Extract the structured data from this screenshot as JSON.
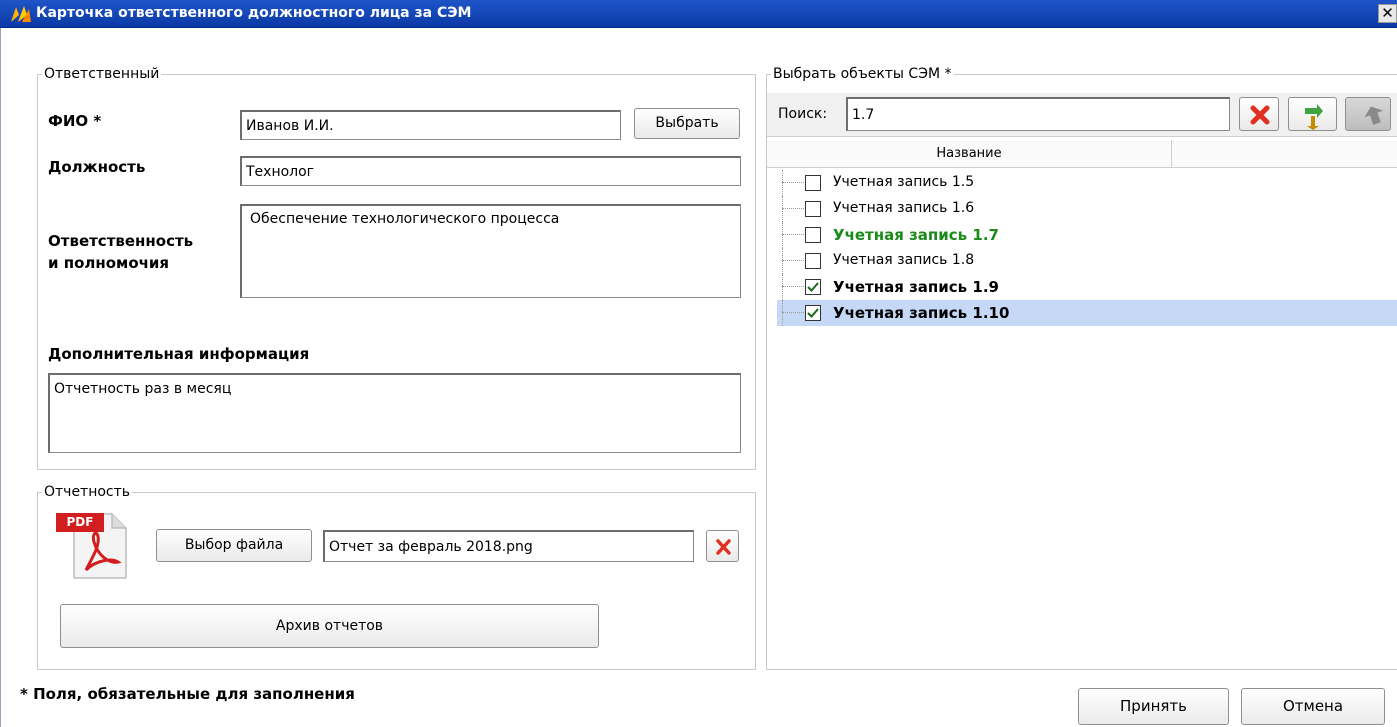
{
  "window": {
    "title": "Карточка ответственного должностного лица за СЭМ",
    "close_glyph": "✕"
  },
  "responsible": {
    "legend": "Ответственный",
    "fio_label": "ФИО *",
    "fio_value": "Иванов И.И.",
    "select_button": "Выбрать",
    "position_label": "Должность",
    "position_value": "Технолог",
    "duties_label_1": "Ответственность",
    "duties_label_2": "и полномочия",
    "duties_value": "Обеспечение технологического процесса",
    "extra_label": "Дополнительная информация",
    "extra_value": "Отчетность раз в месяц"
  },
  "reporting": {
    "legend": "Отчетность",
    "pdf_badge": "PDF",
    "choose_file_button": "Выбор файла",
    "file_value": "Отчет за февраль 2018.png",
    "archive_button": "Архив отчетов"
  },
  "objects": {
    "legend": "Выбрать объекты СЭМ *",
    "search_label": "Поиск:",
    "search_value": "1.7",
    "column_name": "Название",
    "items": [
      {
        "label": "Учетная запись 1.5",
        "checked": false,
        "style": "normal"
      },
      {
        "label": "Учетная запись 1.6",
        "checked": false,
        "style": "normal"
      },
      {
        "label": "Учетная запись 1.7",
        "checked": false,
        "style": "match"
      },
      {
        "label": "Учетная запись 1.8",
        "checked": false,
        "style": "normal"
      },
      {
        "label": "Учетная запись 1.9",
        "checked": true,
        "style": "bold"
      },
      {
        "label": "Учетная запись 1.10",
        "checked": true,
        "style": "bold-selected"
      }
    ]
  },
  "footer": {
    "required_note": "* Поля, обязательные для заполнения",
    "accept_button": "Принять",
    "cancel_button": "Отмена"
  },
  "colors": {
    "title_bar": "#0a3aa6",
    "match_text": "#1a8a1a",
    "selection": "#c5d8f6",
    "delete_red": "#e03020"
  }
}
